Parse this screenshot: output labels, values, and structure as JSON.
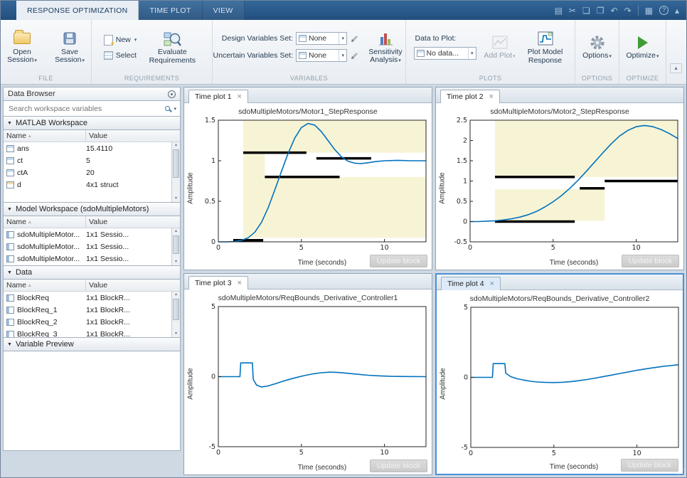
{
  "icons": {
    "caret": "▾",
    "collapse": "▴",
    "section_caret": "▼",
    "close": "×",
    "sort": "▵",
    "save": "▤",
    "cut": "✂",
    "copy": "❏",
    "paste": "❐",
    "undo": "↶",
    "redo": "↷",
    "layout": "▦",
    "help": "?",
    "chevron_up": "▴",
    "scroll_up": "▴",
    "scroll_down": "▾"
  },
  "titlebar": {
    "tabs": [
      {
        "label": "RESPONSE OPTIMIZATION"
      },
      {
        "label": "TIME PLOT"
      },
      {
        "label": "VIEW"
      }
    ]
  },
  "ribbon": {
    "file": {
      "label": "FILE",
      "open": "Open Session",
      "save": "Save Session"
    },
    "requirements": {
      "label": "REQUIREMENTS",
      "new": "New",
      "select": "Select",
      "evaluate": "Evaluate Requirements"
    },
    "variables": {
      "label": "VARIABLES",
      "design": "Design Variables Set:",
      "design_value": "None",
      "uncertain": "Uncertain Variables Set:",
      "uncertain_value": "None",
      "sensitivity": "Sensitivity Analysis"
    },
    "plots": {
      "label": "PLOTS",
      "data_to_plot": "Data to Plot:",
      "data_value": "No data...",
      "add_plot": "Add Plot",
      "plot_model": "Plot Model Response"
    },
    "options": {
      "label": "OPTIONS",
      "button": "Options"
    },
    "optimize": {
      "label": "OPTIMIZE",
      "button": "Optimize"
    }
  },
  "sidebar": {
    "title": "Data Browser",
    "search_placeholder": "Search workspace variables",
    "matlab_ws": {
      "title": "MATLAB Workspace",
      "col_name": "Name",
      "col_value": "Value",
      "rows": [
        {
          "name": "ans",
          "value": "15.4110"
        },
        {
          "name": "ct",
          "value": "5"
        },
        {
          "name": "ctA",
          "value": "20"
        },
        {
          "name": "d",
          "value": "4x1 struct"
        }
      ]
    },
    "model_ws": {
      "title": "Model Workspace (sdoMultipleMotors)",
      "col_name": "Name",
      "col_value": "Value",
      "rows": [
        {
          "name": "sdoMultipleMotor...",
          "value": "1x1 Sessio..."
        },
        {
          "name": "sdoMultipleMotor...",
          "value": "1x1 Sessio..."
        },
        {
          "name": "sdoMultipleMotor...",
          "value": "1x1 Sessio..."
        }
      ]
    },
    "data": {
      "title": "Data",
      "col_name": "Name",
      "col_value": "Value",
      "rows": [
        {
          "name": "BlockReq",
          "value": "1x1 BlockR..."
        },
        {
          "name": "BlockReq_1",
          "value": "1x1 BlockR..."
        },
        {
          "name": "BlockReq_2",
          "value": "1x1 BlockR..."
        },
        {
          "name": "BlockReq_3",
          "value": "1x1 BlockR..."
        }
      ]
    },
    "preview": {
      "title": "Variable Preview"
    }
  },
  "panels": [
    {
      "tab": "Time plot 1",
      "title": "sdoMultipleMotors/Motor1_StepResponse",
      "xlabel": "Time (seconds)",
      "ylabel": "Amplitude",
      "update_button": "Update block",
      "chart": {
        "type": "line",
        "xlim": [
          0,
          12.5
        ],
        "ylim": [
          0,
          1.5
        ],
        "xticks": [
          0,
          5,
          10
        ],
        "yticks": [
          0,
          0.5,
          1,
          1.5
        ],
        "regions": [
          [
            1.5,
            12.5,
            1.1,
            1.5
          ],
          [
            1.5,
            2.8,
            0.05,
            1.1
          ],
          [
            2.8,
            12.5,
            0.05,
            0.8
          ]
        ],
        "bounds": [
          [
            1.5,
            5.3,
            1.1
          ],
          [
            2.8,
            7.3,
            0.8
          ],
          [
            5.9,
            9.2,
            1.03
          ],
          [
            0.9,
            2.7,
            0.02
          ]
        ],
        "x": [
          0,
          0.5,
          1,
          1.4,
          1.8,
          2.2,
          2.6,
          3,
          3.4,
          3.8,
          4.2,
          4.6,
          5,
          5.4,
          5.8,
          6.2,
          6.6,
          7,
          7.4,
          7.8,
          8.2,
          8.6,
          9,
          9.5,
          10,
          10.8,
          11.6,
          12.5
        ],
        "y": [
          0,
          0,
          0.005,
          0.02,
          0.05,
          0.12,
          0.24,
          0.42,
          0.64,
          0.87,
          1.09,
          1.28,
          1.41,
          1.46,
          1.44,
          1.36,
          1.25,
          1.14,
          1.05,
          0.995,
          0.97,
          0.965,
          0.975,
          0.99,
          1,
          1.005,
          1,
          1
        ]
      }
    },
    {
      "tab": "Time plot 2",
      "title": "sdoMultipleMotors/Motor2_StepResponse",
      "xlabel": "Time (seconds)",
      "ylabel": "Amplitude",
      "update_button": "Update block",
      "chart": {
        "type": "line",
        "xlim": [
          0,
          12.5
        ],
        "ylim": [
          -0.5,
          2.5
        ],
        "xticks": [
          0,
          5,
          10
        ],
        "yticks": [
          -0.5,
          0,
          0.5,
          1,
          1.5,
          2,
          2.5
        ],
        "regions": [
          [
            1.5,
            12.5,
            1.1,
            2.5
          ],
          [
            1.5,
            8.1,
            0.02,
            0.8
          ]
        ],
        "bounds": [
          [
            1.5,
            6.3,
            1.1
          ],
          [
            6.6,
            8.1,
            0.82
          ],
          [
            8.1,
            12.5,
            1.0
          ],
          [
            1.5,
            6.3,
            0
          ]
        ],
        "x": [
          0,
          0.5,
          1,
          1.5,
          2,
          2.5,
          3,
          3.5,
          4,
          4.5,
          5,
          5.5,
          6,
          6.5,
          7,
          7.5,
          8,
          8.5,
          9,
          9.5,
          10,
          10.5,
          11,
          11.5,
          12,
          12.5
        ],
        "y": [
          0,
          0,
          0.01,
          0.02,
          0.04,
          0.07,
          0.11,
          0.17,
          0.25,
          0.36,
          0.49,
          0.64,
          0.82,
          1.02,
          1.24,
          1.47,
          1.7,
          1.92,
          2.11,
          2.25,
          2.34,
          2.37,
          2.34,
          2.27,
          2.17,
          2.05
        ]
      }
    },
    {
      "tab": "Time plot 3",
      "title": "sdoMultipleMotors/ReqBounds_Derivative_Controller1",
      "xlabel": "Time (seconds)",
      "ylabel": "Amplitude",
      "update_button": "Update block",
      "chart": {
        "type": "line",
        "xlim": [
          0,
          12.5
        ],
        "ylim": [
          -5,
          5
        ],
        "xticks": [
          0,
          5,
          10
        ],
        "yticks": [
          -5,
          0,
          5
        ],
        "regions": [],
        "bounds": [],
        "x": [
          0,
          0.7,
          1.3,
          1.35,
          2.05,
          2.1,
          2.3,
          2.6,
          3,
          3.4,
          3.8,
          4.2,
          4.7,
          5.2,
          5.7,
          6.2,
          6.7,
          7.2,
          7.8,
          8.4,
          9,
          9.6,
          10.4,
          11.2,
          12.5
        ],
        "y": [
          0,
          0,
          0,
          0.98,
          0.98,
          -0.2,
          -0.6,
          -0.74,
          -0.66,
          -0.52,
          -0.36,
          -0.22,
          -0.06,
          0.08,
          0.2,
          0.28,
          0.32,
          0.3,
          0.24,
          0.17,
          0.1,
          0.06,
          0.02,
          0.01,
          0
        ]
      }
    },
    {
      "tab": "Time plot 4",
      "title": "sdoMultipleMotors/ReqBounds_Derivative_Controller2",
      "xlabel": "Time (seconds)",
      "ylabel": "Amplitude",
      "update_button": "Update block",
      "chart": {
        "type": "line",
        "xlim": [
          0,
          12.5
        ],
        "ylim": [
          -5,
          5
        ],
        "xticks": [
          0,
          5,
          10
        ],
        "yticks": [
          -5,
          0,
          5
        ],
        "regions": [],
        "bounds": [],
        "x": [
          0,
          0.7,
          1.3,
          1.35,
          2.05,
          2.1,
          2.4,
          2.8,
          3.2,
          3.6,
          4,
          4.5,
          5,
          5.5,
          6,
          6.5,
          7,
          7.5,
          8,
          8.5,
          9,
          9.5,
          10,
          10.5,
          11,
          11.5,
          12,
          12.5
        ],
        "y": [
          0,
          0,
          0,
          0.98,
          0.98,
          0.3,
          0.05,
          -0.1,
          -0.2,
          -0.28,
          -0.33,
          -0.36,
          -0.37,
          -0.35,
          -0.31,
          -0.24,
          -0.15,
          -0.05,
          0.06,
          0.17,
          0.28,
          0.39,
          0.5,
          0.6,
          0.69,
          0.77,
          0.84,
          0.9
        ]
      }
    }
  ]
}
